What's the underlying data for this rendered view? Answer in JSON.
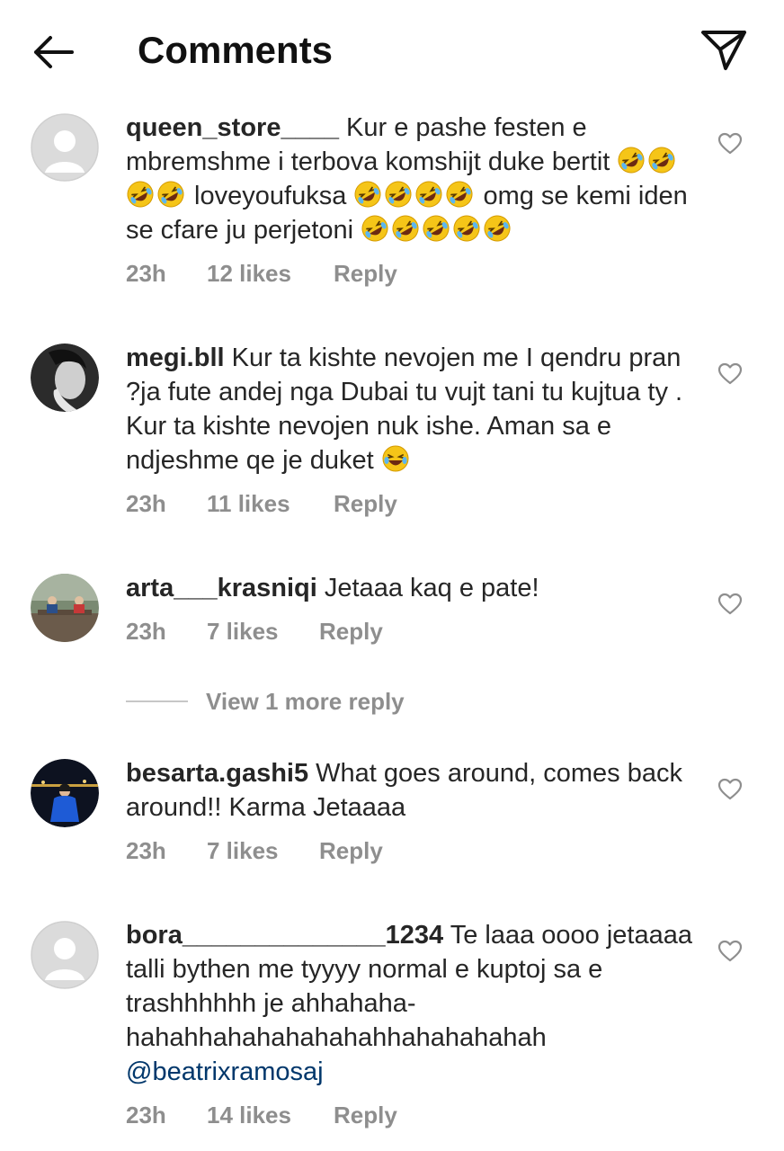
{
  "header": {
    "title": "Comments",
    "back_icon": "arrow-left-icon",
    "share_icon": "paper-plane-icon"
  },
  "colors": {
    "text": "#262626",
    "muted": "#8e8e8e",
    "mention": "#00376b",
    "emoji_face": "#f5c518"
  },
  "comments": [
    {
      "username": "queen_store____",
      "text_parts": [
        "Kur e pashe festen e mbremshme i terbova komshijt duke bertit ",
        " loveyoufuksa ",
        " omg se kemi iden se cfare ju perjetoni "
      ],
      "emojis": [
        "rofl",
        "rofl",
        "rofl",
        "rofl",
        "rofl",
        "rofl",
        "rofl",
        "rofl",
        "rofl",
        "rofl",
        "rofl",
        "rofl",
        "rofl"
      ],
      "time": "23h",
      "likes": "12 likes",
      "reply": "Reply"
    },
    {
      "username": "megi.bll",
      "text": "Kur ta kishte nevojen me I qendru pran ?ja fute andej nga Dubai tu vujt tani tu kujtua ty . Kur ta kishte nevojen nuk ishe. Aman sa e ndjeshme qe je duket ",
      "emojis": [
        "joy"
      ],
      "time": "23h",
      "likes": "11 likes",
      "reply": "Reply"
    },
    {
      "username": "arta___krasniqi",
      "text": "Jetaaa kaq e pate!",
      "time": "23h",
      "likes": "7 likes",
      "reply": "Reply",
      "view_more": "View 1 more reply"
    },
    {
      "username": "besarta.gashi5",
      "text": "What goes around, comes back around!! Karma Jetaaaa",
      "time": "23h",
      "likes": "7 likes",
      "reply": "Reply"
    },
    {
      "username": "bora______________1234",
      "text": "Te laaa oooo jetaaaa talli bythen me tyyyy normal e kuptoj sa e trashhhhhh je ahhahaha-hahahhahahahahahahhahahahahah",
      "mention": "@beatrixramosaj",
      "time": "23h",
      "likes": "14 likes",
      "reply": "Reply"
    }
  ]
}
